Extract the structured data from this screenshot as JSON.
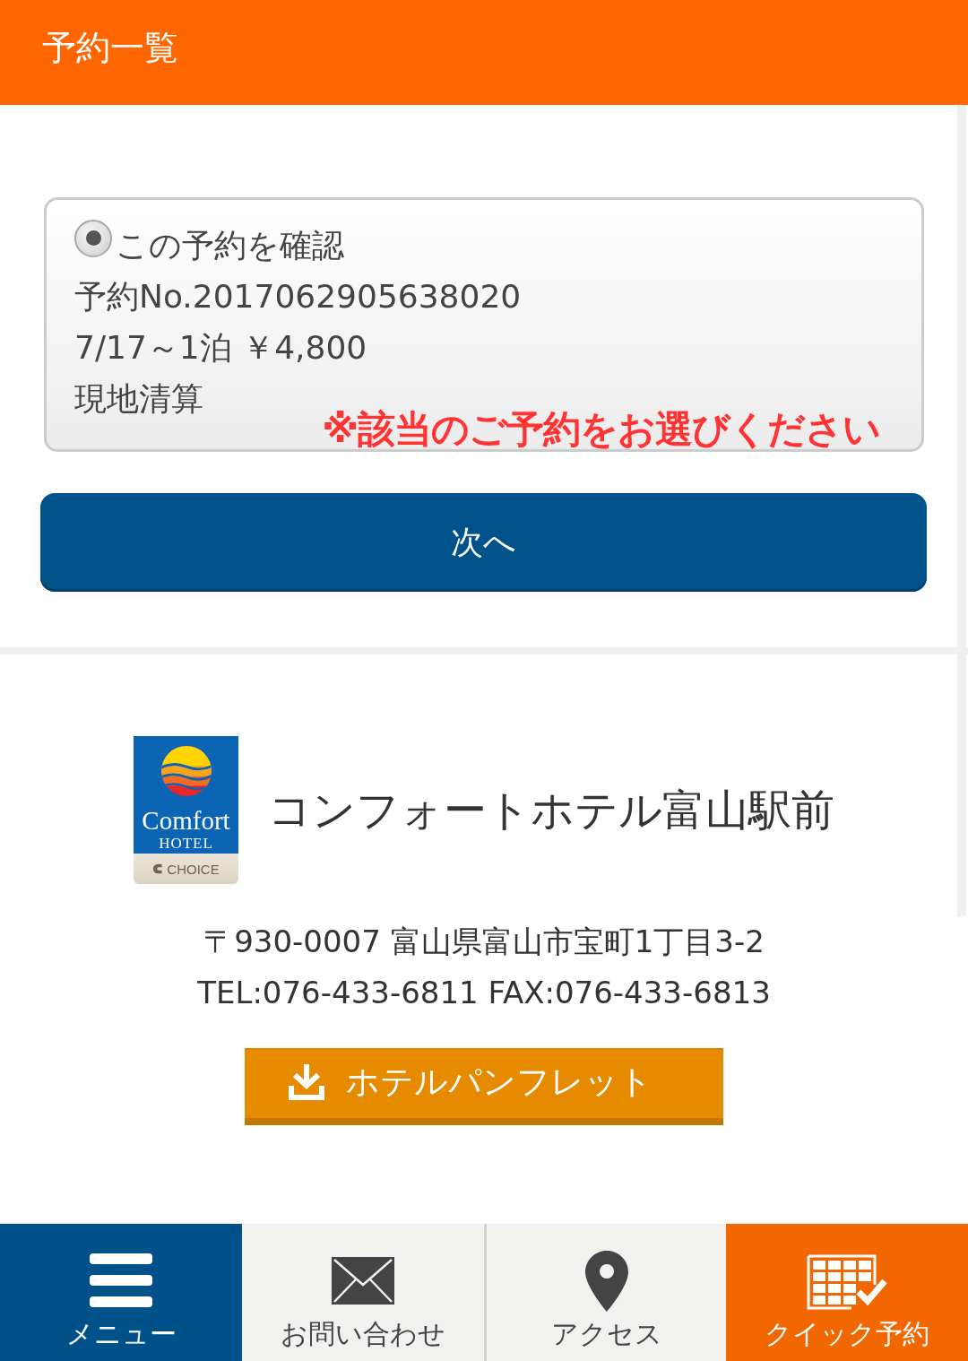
{
  "header": {
    "title": "予約一覧"
  },
  "reservations": [
    {
      "selected": true,
      "label": "この予約を確認",
      "number": "予約No.2017062905638020",
      "stay": "7/17～1泊 ￥4,800",
      "payment": "現地清算"
    }
  ],
  "notice": "※該当のご予約をお選びください",
  "next_button": "次へ",
  "hotel": {
    "logo": {
      "wordmark": "Comfort",
      "subtitle": "HOTEL",
      "brand": "CHOICE"
    },
    "name": "コンフォートホテル富山駅前",
    "address": "〒930-0007 富山県富山市宝町1丁目3-2",
    "contact": "TEL:076-433-6811 FAX:076-433-6813",
    "pamphlet_button": "ホテルパンフレット"
  },
  "bottom_nav": [
    {
      "kind": "menu",
      "label": "メニュー"
    },
    {
      "kind": "contact",
      "label": "お問い合わせ"
    },
    {
      "kind": "access",
      "label": "アクセス"
    },
    {
      "kind": "quick_reservation",
      "label": "クイック予約"
    }
  ]
}
